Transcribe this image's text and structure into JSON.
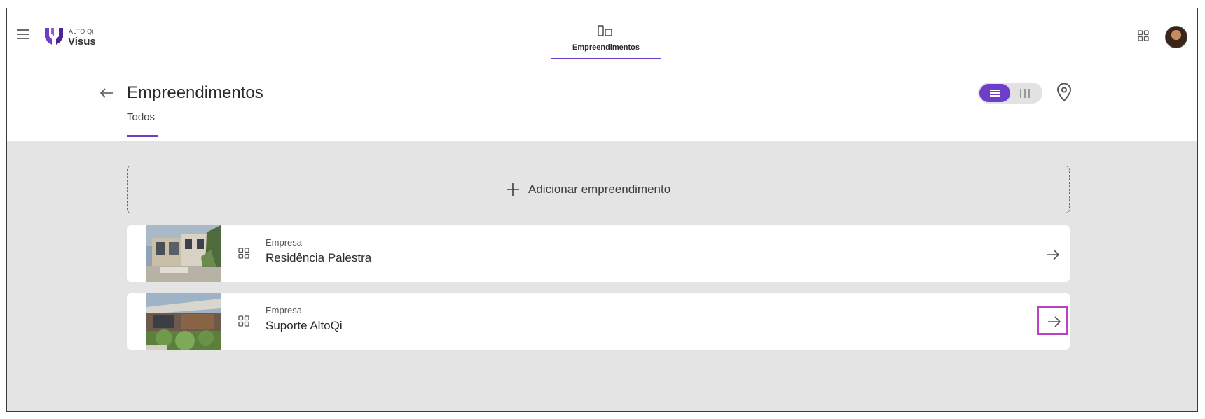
{
  "topbar": {
    "brand_small": "ALTO Qi",
    "brand_name": "Visus",
    "center_tab_label": "Empreendimentos",
    "accent_color": "#6c3ec9"
  },
  "header": {
    "title": "Empreendimentos",
    "tab_label": "Todos"
  },
  "add_button_label": "Adicionar empreendimento",
  "projects": [
    {
      "type": "Empresa",
      "name": "Residência Palestra"
    },
    {
      "type": "Empresa",
      "name": "Suporte AltoQi"
    }
  ],
  "icons": [
    "menu-icon",
    "visus-logo",
    "project-tab-icon",
    "apps-grid-icon",
    "avatar",
    "back-arrow-icon",
    "list-view-icon",
    "column-view-icon",
    "location-pin-icon",
    "plus-icon",
    "grid-icon",
    "arrow-right-icon"
  ]
}
